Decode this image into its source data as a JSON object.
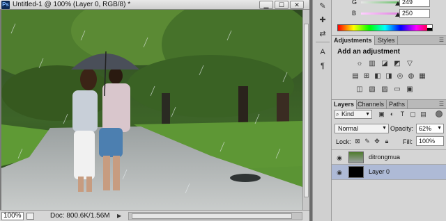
{
  "document": {
    "ps_logo": "Ps",
    "title": "Untitled-1 @ 100% (Layer 0, RGB/8) *",
    "minimize": "▁",
    "maximize": "☐",
    "close": "✕",
    "zoom": "100%",
    "doc_info": "Doc: 800.6K/1.56M",
    "status_arrow": "▶"
  },
  "tools": [
    {
      "name": "brush-icon",
      "glyph": "✎"
    },
    {
      "name": "clone-icon",
      "glyph": "✚"
    },
    {
      "name": "adjust-icon",
      "glyph": "⇄"
    },
    {
      "name": "type-icon",
      "glyph": "A"
    },
    {
      "name": "paragraph-icon",
      "glyph": "¶"
    }
  ],
  "color_panel": {
    "g_label": "G",
    "g_value": "249",
    "b_label": "B",
    "b_value": "250",
    "g_color": "#22aa22",
    "b_color": "#cc55cc"
  },
  "adjustments": {
    "tabs": [
      "Adjustments",
      "Styles"
    ],
    "heading": "Add an adjustment",
    "icons": [
      "brightness-icon",
      "levels-icon",
      "curves-icon",
      "exposure-icon",
      "gradient-icon",
      "vibrance-icon",
      "hue-icon",
      "color-balance-icon",
      "bw-icon",
      "photo-filter-icon",
      "channel-mixer-icon",
      "color-lookup-icon",
      "invert-icon",
      "posterize-icon",
      "threshold-icon",
      "gradient-map-icon",
      "selective-color-icon"
    ]
  },
  "layers": {
    "tabs": [
      "Layers",
      "Channels",
      "Paths"
    ],
    "kind": "Kind",
    "blend_mode": "Normal",
    "opacity_label": "Opacity:",
    "opacity": "62%",
    "lock_label": "Lock:",
    "fill_label": "Fill:",
    "fill": "100%",
    "items": [
      {
        "name": "ditrongmua",
        "selected": false
      },
      {
        "name": "Layer 0",
        "selected": true
      }
    ]
  }
}
